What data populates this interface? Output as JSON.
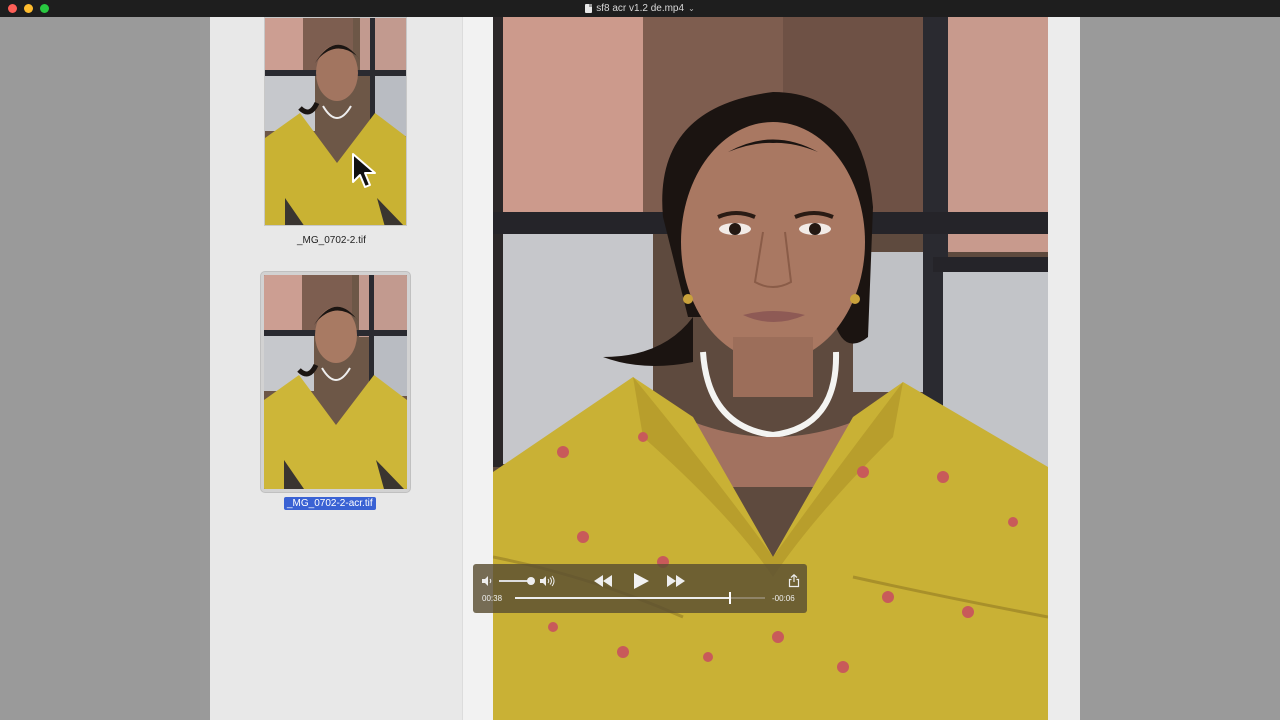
{
  "window": {
    "title": "sf8 acr v1.2 de.mp4"
  },
  "colors": {
    "close": "#fe5f57",
    "minimize": "#febc2e",
    "zoom": "#28c840",
    "selection": "#3a62d4"
  },
  "sidebar": {
    "items": [
      {
        "label": "_MG_0702-2.tif",
        "selected": false
      },
      {
        "label": "_MG_0702-2-acr.tif",
        "selected": true
      }
    ]
  },
  "player": {
    "elapsed": "00:38",
    "remaining": "-00:06",
    "progress_fraction": 0.86,
    "volume_fraction": 0.85,
    "icons": {
      "volume_low": "speaker-low-icon",
      "volume_high": "speaker-high-icon",
      "rewind": "rewind-icon",
      "play": "play-icon",
      "fast_forward": "fast-forward-icon",
      "share": "share-icon"
    }
  }
}
